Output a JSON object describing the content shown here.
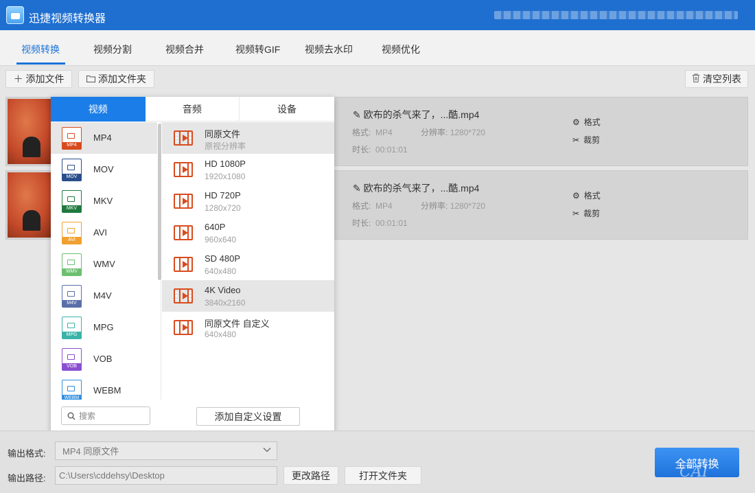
{
  "window": {
    "title": "迅捷视频转换器"
  },
  "tabs": [
    "视频转换",
    "视频分割",
    "视频合并",
    "视频转GIF",
    "视频去水印",
    "视频优化"
  ],
  "toolbar": {
    "add_file": "添加文件",
    "add_folder": "添加文件夹",
    "clear_list": "清空列表"
  },
  "files": [
    {
      "name": "欧布的杀气来了，...酷.mp4",
      "format_label": "格式:",
      "format": "MP4",
      "res_label": "分辨率:",
      "resolution": "1280*720",
      "duration_label": "时长:",
      "duration": "00:01:01",
      "action_format": "格式",
      "action_cut": "裁剪"
    },
    {
      "name": "欧布的杀气来了，...酷.mp4",
      "format_label": "格式:",
      "format": "MP4",
      "res_label": "分辨率:",
      "resolution": "1280*720",
      "duration_label": "时长:",
      "duration": "00:01:01",
      "action_format": "格式",
      "action_cut": "裁剪"
    }
  ],
  "popup": {
    "tabs": [
      "视频",
      "音频",
      "设备"
    ],
    "formats": [
      {
        "label": "MP4",
        "color": "#d84b1e"
      },
      {
        "label": "MOV",
        "color": "#2a4e8c"
      },
      {
        "label": "MKV",
        "color": "#1f7a3e"
      },
      {
        "label": "AVI",
        "color": "#f0a030"
      },
      {
        "label": "WMV",
        "color": "#6cbf70"
      },
      {
        "label": "M4V",
        "color": "#5a6fa8"
      },
      {
        "label": "MPG",
        "color": "#3bb3a8"
      },
      {
        "label": "VOB",
        "color": "#8a4fd0"
      },
      {
        "label": "WEBM",
        "color": "#2f8fe0"
      }
    ],
    "resolutions": [
      {
        "name": "同原文件",
        "sub": "原视分辨率"
      },
      {
        "name": "HD 1080P",
        "sub": "1920x1080"
      },
      {
        "name": "HD 720P",
        "sub": "1280x720"
      },
      {
        "name": "640P",
        "sub": "960x640"
      },
      {
        "name": "SD 480P",
        "sub": "640x480"
      },
      {
        "name": "4K Video",
        "sub": "3840x2160"
      },
      {
        "name": "同原文件 自定义",
        "sub": "640x480"
      }
    ],
    "search_placeholder": "搜索",
    "add_custom": "添加自定义设置"
  },
  "bottom": {
    "format_label": "输出格式:",
    "format_value": "MP4  同原文件",
    "path_label": "输出路径:",
    "path_value": "C:\\Users\\cddehsy\\Desktop",
    "change_path": "更改路径",
    "open_folder": "打开文件夹",
    "convert_all": "全部转换"
  }
}
